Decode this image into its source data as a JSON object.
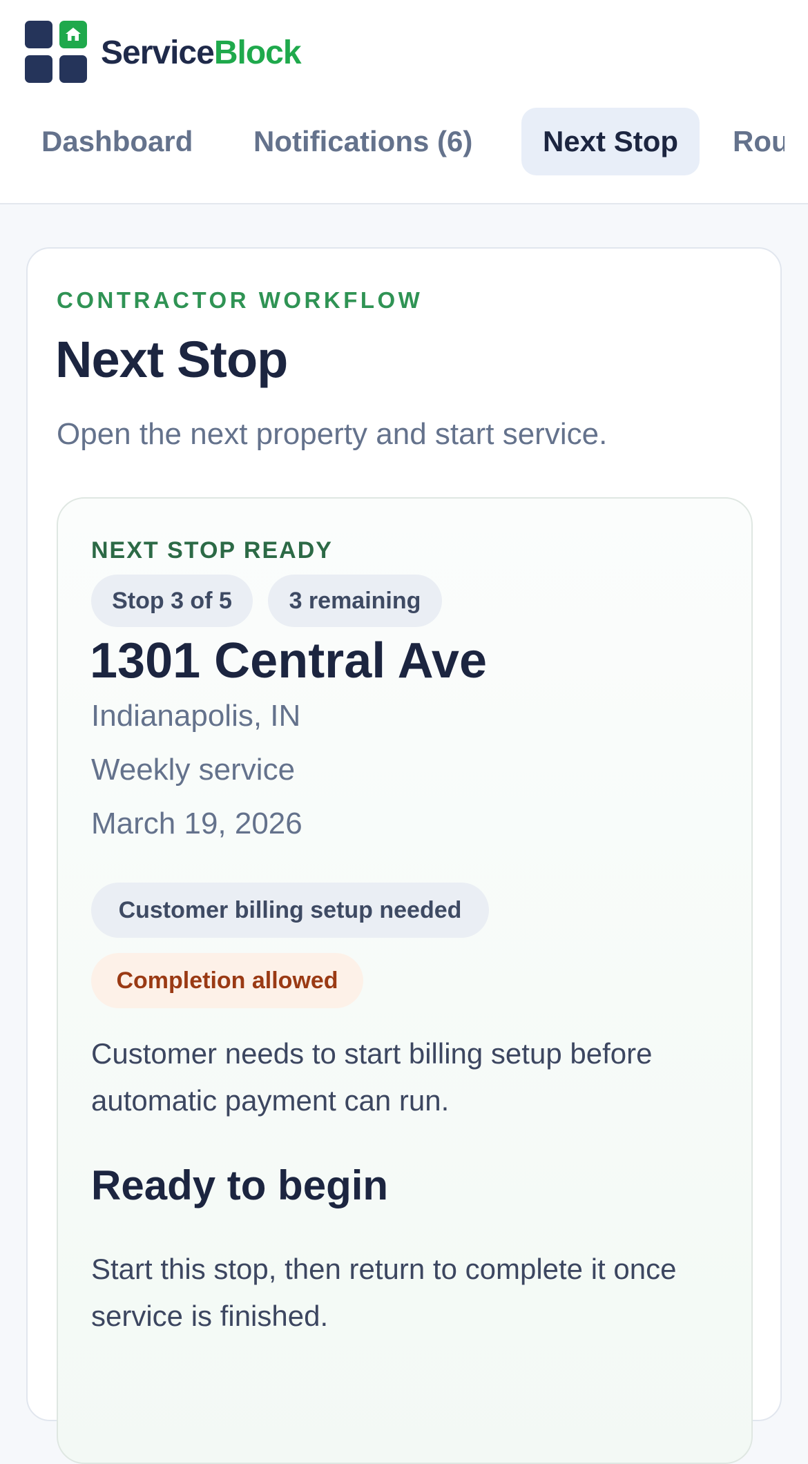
{
  "brand": {
    "name_part1": "Service",
    "name_part2": "Block",
    "logo_icon": "home-icon",
    "colors": {
      "navy": "#25345a",
      "green": "#1fa94c"
    }
  },
  "nav": {
    "tabs": [
      {
        "label": "Dashboard",
        "active": false
      },
      {
        "label": "Notifications (6)",
        "active": false
      },
      {
        "label": "Next Stop",
        "active": true
      },
      {
        "label": "Route",
        "active": false
      }
    ]
  },
  "page": {
    "eyebrow": "CONTRACTOR WORKFLOW",
    "title": "Next Stop",
    "subtitle": "Open the next property and start service."
  },
  "stop": {
    "status_label": "NEXT STOP READY",
    "position_pill": "Stop 3 of 5",
    "remaining_pill": "3 remaining",
    "address": "1301 Central Ave",
    "city": "Indianapolis, IN",
    "service_type": "Weekly service",
    "date": "March 19, 2026",
    "badges": [
      {
        "label": "Customer billing setup needed",
        "color": "#3e4a63"
      },
      {
        "label": "Completion allowed",
        "color": "#9a3a14"
      }
    ],
    "note": "Customer needs to start billing setup before automatic payment can run.",
    "section_title": "Ready to begin",
    "section_body": "Start this stop, then return to complete it once service is finished."
  }
}
